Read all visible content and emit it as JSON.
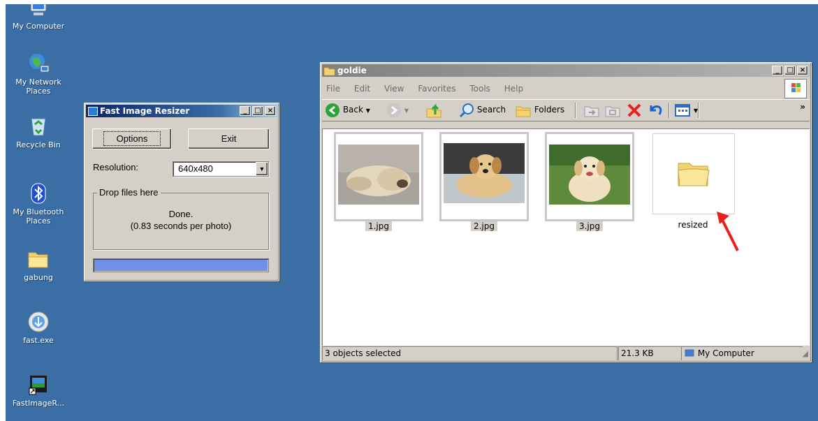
{
  "desktop": {
    "icons": [
      {
        "label": "My Computer",
        "icon": "my-computer-icon"
      },
      {
        "label": "My Network Places",
        "icon": "network-places-icon"
      },
      {
        "label": "Recycle Bin",
        "icon": "recycle-bin-icon"
      },
      {
        "label": "My Bluetooth Places",
        "icon": "bluetooth-icon"
      },
      {
        "label": "gabung",
        "icon": "folder-icon"
      },
      {
        "label": "fast.exe",
        "icon": "installer-icon"
      },
      {
        "label": "FastImageR...",
        "icon": "app-shortcut-icon"
      }
    ],
    "background_color": "#3a6ea5"
  },
  "resizer": {
    "title": "Fast Image Resizer",
    "options_label": "Options",
    "exit_label": "Exit",
    "resolution_label": "Resolution:",
    "resolution_value": "640x480",
    "drop_legend": "Drop files here",
    "status_line1": "Done.",
    "status_line2": "(0.83 seconds per photo)",
    "progress": 1.0,
    "progress_color": "#6f8fe8"
  },
  "explorer": {
    "title": "goldie",
    "menu": [
      "File",
      "Edit",
      "View",
      "Favorites",
      "Tools",
      "Help"
    ],
    "toolbar": {
      "back": "Back",
      "search": "Search",
      "folders": "Folders",
      "chevron": "»"
    },
    "files": [
      {
        "name": "1.jpg",
        "selected": true
      },
      {
        "name": "2.jpg",
        "selected": true
      },
      {
        "name": "3.jpg",
        "selected": true
      },
      {
        "name": "resized",
        "type": "folder"
      }
    ],
    "status": {
      "selection": "3 objects selected",
      "size": "21.3 KB",
      "zone": "My Computer"
    }
  },
  "annotation": {
    "arrow_color": "#e8211d"
  }
}
